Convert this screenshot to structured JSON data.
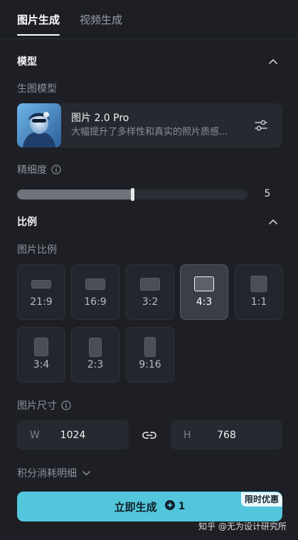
{
  "tabs": [
    {
      "label": "图片生成",
      "active": true
    },
    {
      "label": "视频生成",
      "active": false
    }
  ],
  "model_section": {
    "title": "模型",
    "field_label": "生图模型",
    "model": {
      "name": "图片 2.0 Pro",
      "description": "大幅提升了多样性和真实的照片质感..."
    }
  },
  "detail": {
    "label": "精细度",
    "value": "5",
    "fill_fraction": 0.5
  },
  "ratio_section": {
    "title": "比例",
    "field_label": "图片比例",
    "options": [
      {
        "label": "21:9",
        "selected": false
      },
      {
        "label": "16:9",
        "selected": false
      },
      {
        "label": "3:2",
        "selected": false
      },
      {
        "label": "4:3",
        "selected": true
      },
      {
        "label": "1:1",
        "selected": false
      },
      {
        "label": "3:4",
        "selected": false
      },
      {
        "label": "2:3",
        "selected": false
      },
      {
        "label": "9:16",
        "selected": false
      }
    ]
  },
  "size": {
    "label": "图片尺寸",
    "width_prefix": "W",
    "width": "1024",
    "height_prefix": "H",
    "height": "768"
  },
  "credits": {
    "label": "积分消耗明细"
  },
  "generate": {
    "label": "立即生成",
    "cost": "1",
    "promo": "限时优惠"
  },
  "watermark": "知乎 @无为设计研究所",
  "colors": {
    "background": "#1d1f25",
    "accent": "#53c6db",
    "card": "#262930"
  }
}
